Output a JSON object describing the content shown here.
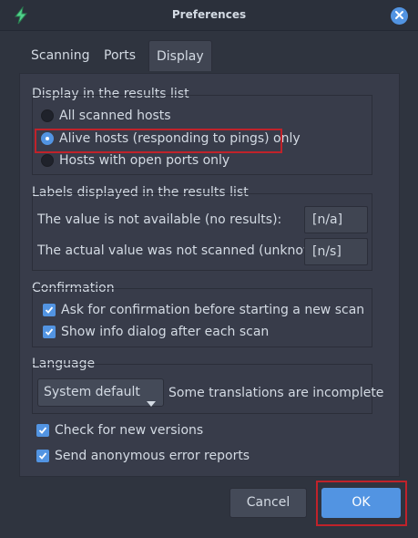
{
  "window": {
    "title": "Preferences"
  },
  "tabs": [
    {
      "label": "Scanning",
      "active": false
    },
    {
      "label": "Ports",
      "active": false
    },
    {
      "label": "Display",
      "active": true
    }
  ],
  "display_results": {
    "title": "Display in the results list",
    "options": [
      {
        "label": "All scanned hosts",
        "selected": false
      },
      {
        "label": "Alive hosts (responding to pings) only",
        "selected": true
      },
      {
        "label": "Hosts with open ports only",
        "selected": false
      }
    ]
  },
  "labels_section": {
    "title": "Labels displayed in the results list",
    "not_available_label": "The value is not available (no results):",
    "not_available_value": "[n/a]",
    "not_scanned_label": "The actual value was not scanned (unknown):",
    "not_scanned_value": "[n/s]"
  },
  "confirmation": {
    "title": "Confirmation",
    "ask_before_scan": {
      "label": "Ask for confirmation before starting a new scan",
      "checked": true
    },
    "show_info_after_scan": {
      "label": "Show info dialog after each scan",
      "checked": true
    }
  },
  "language": {
    "title": "Language",
    "selected": "System default",
    "note": "Some translations are incomplete"
  },
  "misc": {
    "check_versions": {
      "label": "Check for new versions",
      "checked": true
    },
    "send_reports": {
      "label": "Send anonymous error reports",
      "checked": true
    }
  },
  "buttons": {
    "cancel": "Cancel",
    "ok": "OK"
  },
  "colors": {
    "accent": "#5294e2",
    "highlight": "#c0222a",
    "background": "#2f343f"
  },
  "icons": {
    "app": "lightning-icon",
    "close": "close-icon"
  }
}
